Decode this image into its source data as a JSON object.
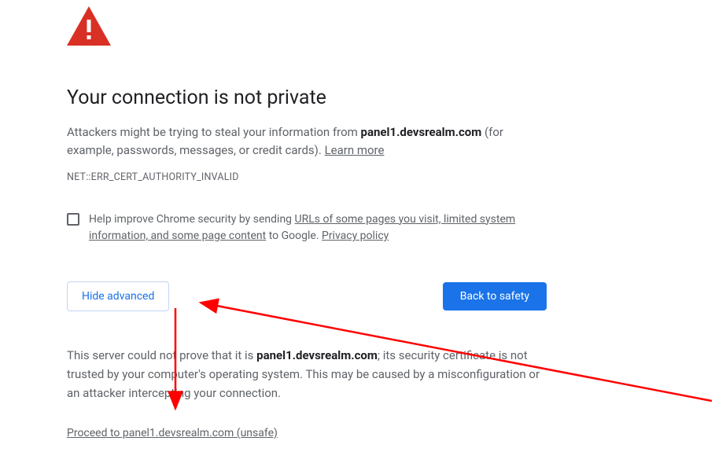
{
  "heading": "Your connection is not private",
  "body": {
    "prefix": "Attackers might be trying to steal your information from ",
    "domain": "panel1.devsrealm.com",
    "suffix": " (for example, passwords, messages, or credit cards). ",
    "learn_more": "Learn more"
  },
  "error_code": "NET::ERR_CERT_AUTHORITY_INVALID",
  "opt_in": {
    "prefix": "Help improve Chrome security by sending ",
    "link1": "URLs of some pages you visit, limited system information, and some page content",
    "mid": " to Google. ",
    "link2": "Privacy policy"
  },
  "buttons": {
    "hide_advanced": "Hide advanced",
    "back_to_safety": "Back to safety"
  },
  "details": {
    "p1": "This server could not prove that it is ",
    "domain": "panel1.devsrealm.com",
    "p2": "; its security certificate is not trusted by your computer's operating system. This may be caused by a misconfiguration or an attacker intercepting your connection."
  },
  "proceed_link": "Proceed to panel1.devsrealm.com (unsafe)",
  "colors": {
    "danger": "#d93025",
    "primary": "#1a73e8",
    "text_muted": "#5f6368"
  }
}
